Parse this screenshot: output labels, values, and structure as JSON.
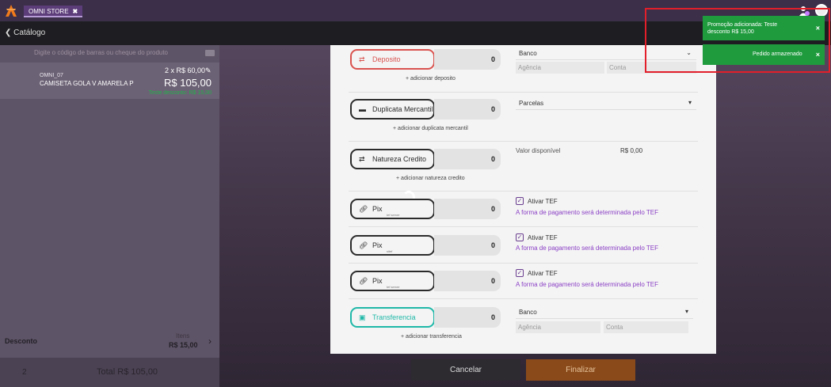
{
  "header": {
    "store_tab": "OMNI STORE",
    "store_tab_close": "✖",
    "back_label": "Catálogo"
  },
  "left": {
    "barcode_placeholder": "Digite o código de barras ou cheque do produto",
    "item": {
      "code": "OMNI_07",
      "name": "CAMISETA GOLA V AMARELA P",
      "qty": "2 x R$ 60,00",
      "price": "R$ 105,00",
      "promo": "Teste desconto: R$ 15,00"
    },
    "discount_label": "Desconto",
    "itens_label": "Itens",
    "discount_value": "R$ 15,00",
    "quantity_total": "2",
    "total": "Total R$ 105,00"
  },
  "payments": [
    {
      "label": "Deposito",
      "amount": "0",
      "add": "adicionar deposito"
    },
    {
      "label": "Duplicata Mercantil",
      "amount": "0",
      "add": "adicionar duplicata mercantil"
    },
    {
      "label": "Natureza Credito",
      "amount": "0",
      "add": "adicionar natureza credito"
    },
    {
      "label": "Pix",
      "sub": "tef server",
      "amount": "0"
    },
    {
      "label": "Pix",
      "sub": "sitef",
      "amount": "0"
    },
    {
      "label": "Pix",
      "sub": "tef server",
      "amount": "0"
    },
    {
      "label": "Transferencia",
      "amount": "0",
      "add": "adicionar transferencia"
    }
  ],
  "details": {
    "banco": "Banco",
    "agencia": "Agência",
    "conta": "Conta",
    "parcelas": "Parcelas",
    "valor_disponivel": "Valor disponível",
    "valor_value": "R$ 0,00",
    "ativar_tef": "Ativar TEF",
    "tef_note": "A forma de pagamento será determinada pelo TEF"
  },
  "actions": {
    "cancel": "Cancelar",
    "finalize": "Finalizar"
  },
  "toasts": {
    "promo": "Promoção adicionada: Teste desconto R$ 15,00",
    "stored": "Pedido armazenado",
    "close": "×"
  },
  "colors": {
    "accent": "#6a3d8f",
    "success": "#1f9b3e",
    "danger": "#d9534f",
    "teal": "#1fb8a8"
  }
}
